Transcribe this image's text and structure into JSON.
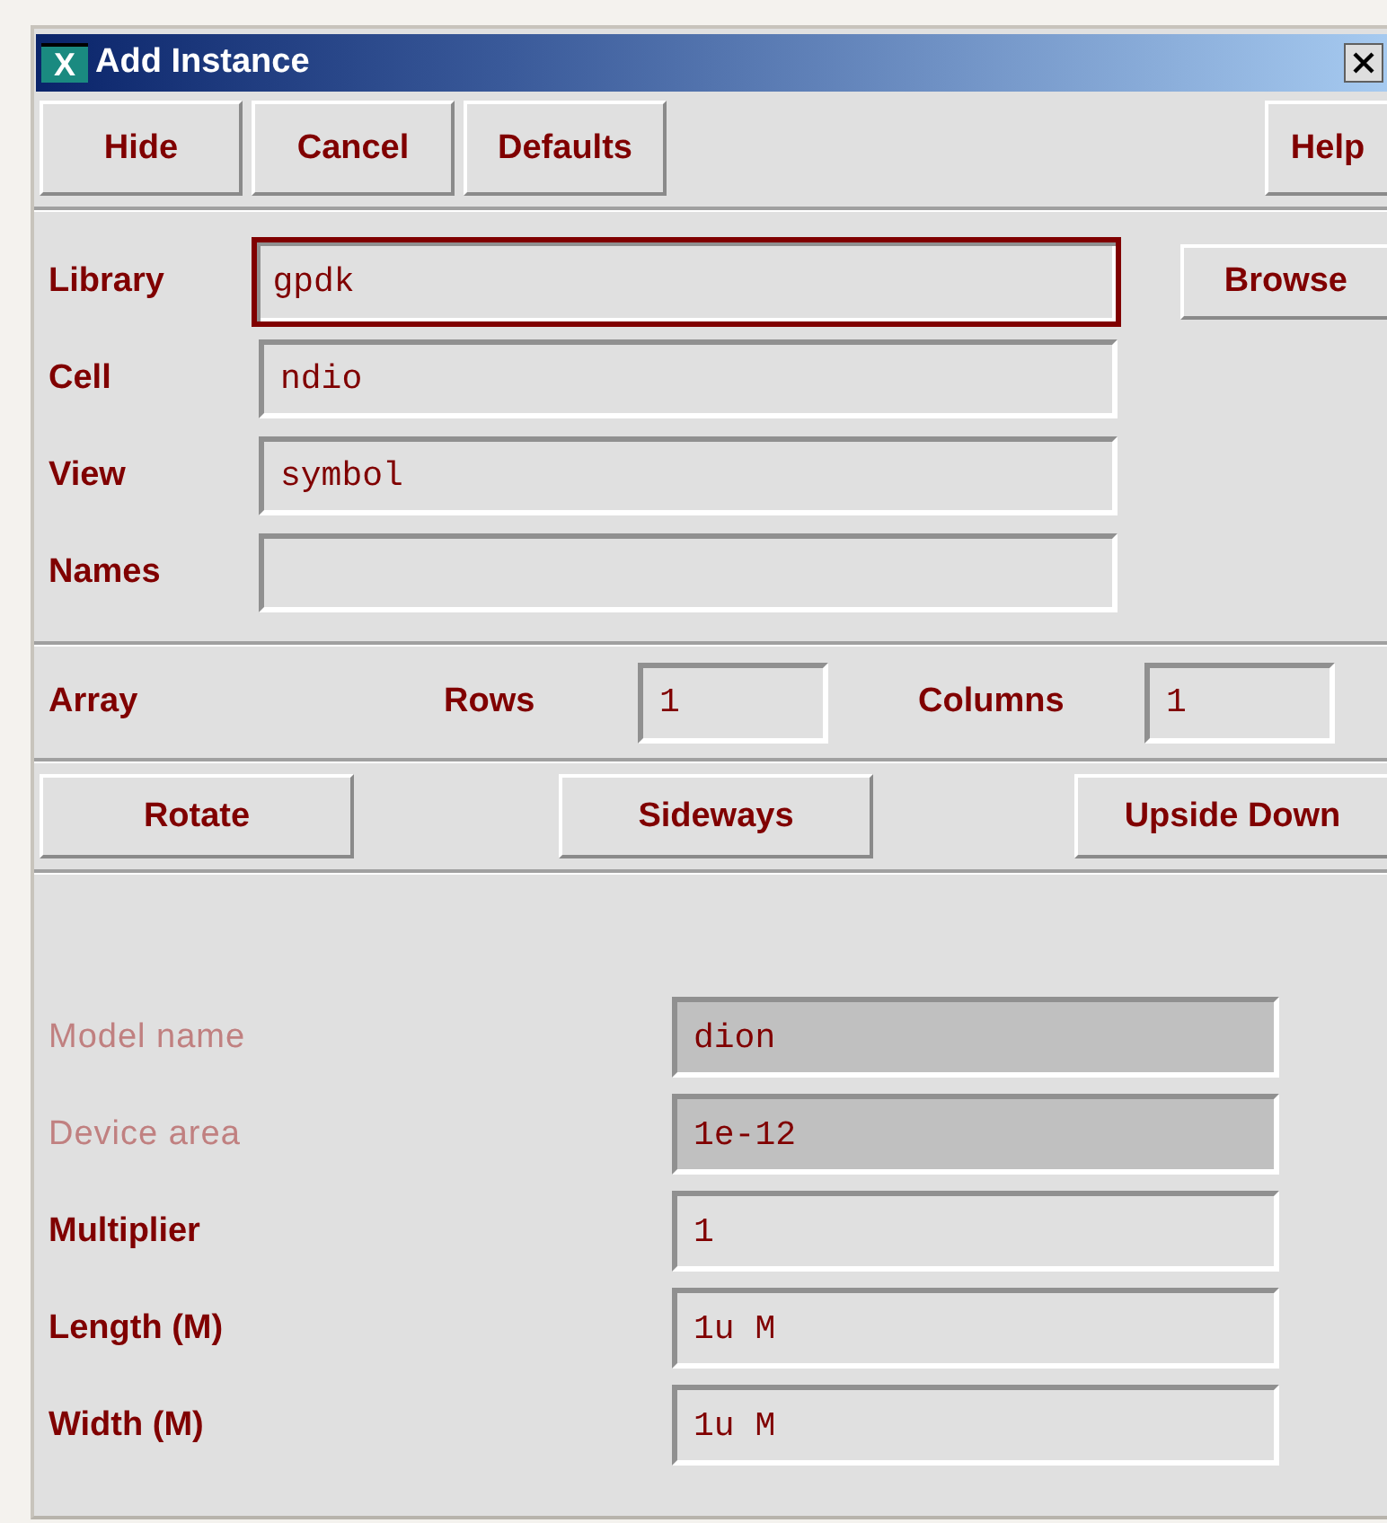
{
  "window": {
    "title": "Add Instance",
    "app_letter": "X"
  },
  "top_buttons": {
    "left": [
      "Hide",
      "Cancel",
      "Defaults"
    ],
    "right": [
      "Help"
    ]
  },
  "cell_fields": [
    {
      "label": "Library",
      "value": "gpdk",
      "focused": true,
      "button": "Browse"
    },
    {
      "label": "Cell",
      "value": "ndio",
      "focused": false
    },
    {
      "label": "View",
      "value": "symbol",
      "focused": false
    },
    {
      "label": "Names",
      "focused": false
    }
  ],
  "array": {
    "label": "Array",
    "rows_label": "Rows",
    "rows": "1",
    "columns_label": "Columns",
    "columns": "1"
  },
  "orient_buttons": [
    "Rotate",
    "Sideways",
    "Upside Down"
  ],
  "parameters": [
    {
      "label": "Model name",
      "value": "dion",
      "disabled": true
    },
    {
      "label": "Device area",
      "value": "1e-12",
      "disabled": true
    },
    {
      "label": "Multiplier",
      "value": "1",
      "disabled": false
    },
    {
      "label": "Length (M)",
      "value": "1u M",
      "disabled": false
    },
    {
      "label": "Width (M)",
      "value": "1u M",
      "disabled": false
    }
  ]
}
